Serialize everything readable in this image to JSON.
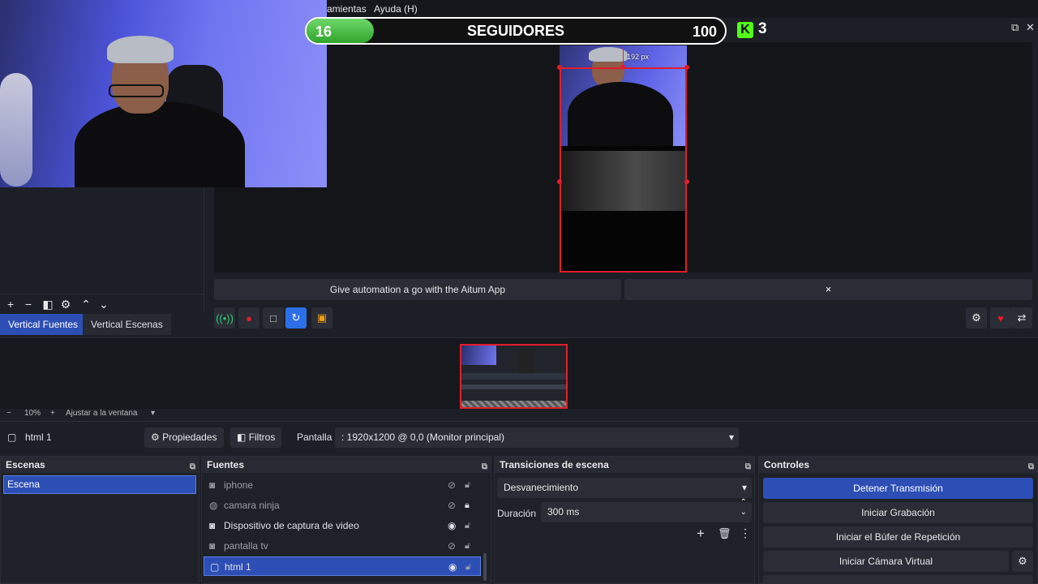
{
  "menu": {
    "item_tools": "amientas",
    "item_help": "Ayuda (H)"
  },
  "overlay": {
    "followers_current": "16",
    "followers_title": "SEGUIDORES",
    "followers_goal": "100",
    "followers_progress": 0.16,
    "kick_logo": "K",
    "kick_count": "3"
  },
  "preview": {
    "size_label": "192 px"
  },
  "left_dock": {
    "tabs": [
      "Vertical Fuentes",
      "Vertical Escenas"
    ]
  },
  "banner": {
    "text": "Give automation a go with the Aitum App",
    "close": "×"
  },
  "zoom": {
    "minus": "−",
    "value": "10%",
    "plus": "+",
    "fit": "Ajustar a la ventana"
  },
  "props_bar": {
    "source_name": "html 1",
    "properties_btn": "Propiedades",
    "filters_btn": "Filtros",
    "display_label": "Pantalla",
    "display_value": ": 1920x1200 @ 0,0 (Monitor principal)"
  },
  "scenes": {
    "title": "Escenas",
    "items": [
      "Escena"
    ]
  },
  "sources": {
    "title": "Fuentes",
    "items": [
      {
        "label": "iphone",
        "icon": "camera-icon",
        "visible": false,
        "locked": false
      },
      {
        "label": "camara ninja",
        "icon": "globe-icon",
        "visible": false,
        "locked": true
      },
      {
        "label": "Dispositivo de captura de video",
        "icon": "camera-icon",
        "visible": true,
        "locked": false
      },
      {
        "label": "pantalla tv",
        "icon": "camera-icon",
        "visible": false,
        "locked": false
      },
      {
        "label": "html 1",
        "icon": "monitor-icon",
        "visible": true,
        "locked": false
      }
    ]
  },
  "transitions": {
    "title": "Transiciones de escena",
    "selected": "Desvanecimiento",
    "duration_label": "Duración",
    "duration_value": "300 ms"
  },
  "controls": {
    "title": "Controles",
    "buttons": [
      "Detener Transmisión",
      "Iniciar Grabación",
      "Iniciar el Búfer de Repetición",
      "Iniciar Cámara Virtual"
    ]
  },
  "colors": {
    "accent": "#2d4fb5",
    "selection": "#e11d2a",
    "kick": "#53fc18"
  }
}
